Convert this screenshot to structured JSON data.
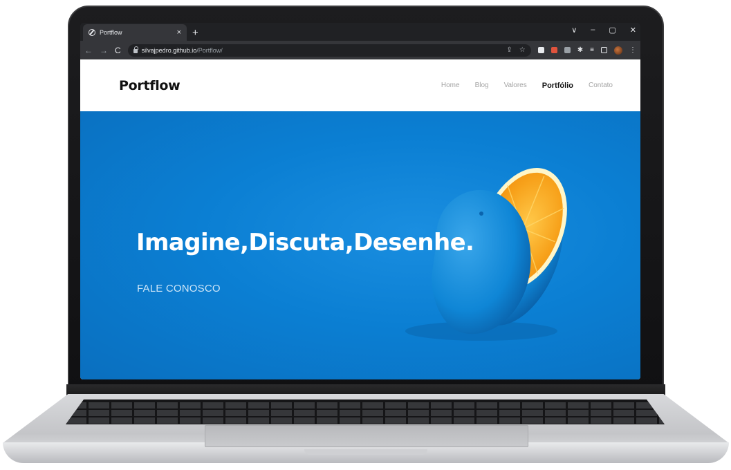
{
  "browser": {
    "tab_title": "Portflow",
    "tab_close": "×",
    "new_tab": "+",
    "window_controls": [
      "∨",
      "–",
      "▢",
      "✕"
    ],
    "nav": {
      "back": "←",
      "forward": "→",
      "reload": "C"
    },
    "url_host": "silvajpedro.github.io",
    "url_path": "/Portflow/",
    "accent": "#202124"
  },
  "site": {
    "logo": "Portflow",
    "nav": {
      "home": "Home",
      "blog": "Blog",
      "valores": "Valores",
      "portfolio": "Portfólio",
      "contato": "Contato"
    },
    "hero": {
      "title": "Imagine,Discuta,Desenhe.",
      "cta": "FALE CONOSCO"
    },
    "colors": {
      "hero_bg": "#0b7fd3",
      "orange": "#f7a11a"
    }
  }
}
